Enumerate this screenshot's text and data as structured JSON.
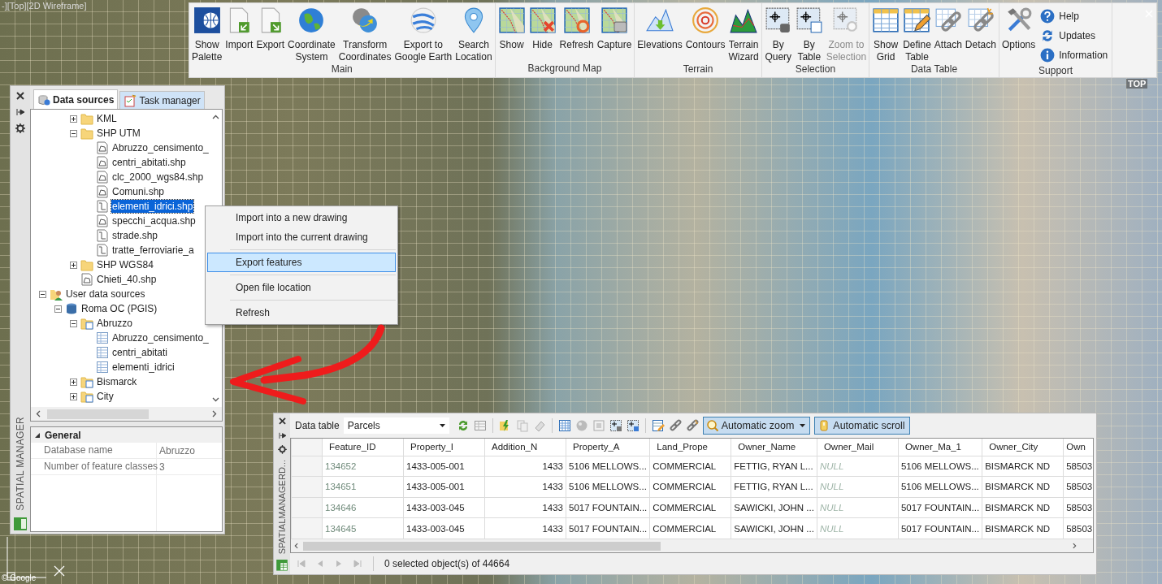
{
  "viewport_label": "-][Top][2D Wireframe]",
  "map": {
    "viewcube_label": "TOP",
    "attribution": "© Google"
  },
  "ribbon": {
    "groups": [
      {
        "label": "Main",
        "buttons": [
          {
            "lines": [
              "Show",
              "Palette"
            ],
            "kind": "large",
            "disabled": false
          },
          {
            "lines": [
              "Import"
            ],
            "kind": "large",
            "disabled": false
          },
          {
            "lines": [
              "Export"
            ],
            "kind": "large",
            "disabled": false
          },
          {
            "lines": [
              "Coordinate",
              "System"
            ],
            "kind": "large",
            "disabled": false
          },
          {
            "lines": [
              "Transform",
              "Coordinates"
            ],
            "kind": "large",
            "disabled": false
          },
          {
            "lines": [
              "Export to",
              "Google Earth"
            ],
            "kind": "large",
            "disabled": false
          },
          {
            "lines": [
              "Search",
              "Location"
            ],
            "kind": "large",
            "disabled": false
          }
        ]
      },
      {
        "label": "Background Map",
        "buttons": [
          {
            "lines": [
              "Show"
            ],
            "kind": "large",
            "disabled": false
          },
          {
            "lines": [
              "Hide"
            ],
            "kind": "large",
            "disabled": false
          },
          {
            "lines": [
              "Refresh"
            ],
            "kind": "large",
            "disabled": false
          },
          {
            "lines": [
              "Capture"
            ],
            "kind": "large",
            "disabled": false
          }
        ]
      },
      {
        "label": "Terrain",
        "buttons": [
          {
            "lines": [
              "Elevations"
            ],
            "kind": "large",
            "disabled": false
          },
          {
            "lines": [
              "Contours"
            ],
            "kind": "large",
            "disabled": false
          },
          {
            "lines": [
              "Terrain",
              "Wizard"
            ],
            "kind": "large",
            "disabled": false
          }
        ]
      },
      {
        "label": "Selection",
        "buttons": [
          {
            "lines": [
              "By",
              "Query"
            ],
            "kind": "large",
            "disabled": false
          },
          {
            "lines": [
              "By",
              "Table"
            ],
            "kind": "large",
            "disabled": false
          },
          {
            "lines": [
              "Zoom to",
              "Selection"
            ],
            "kind": "large",
            "disabled": true
          }
        ]
      },
      {
        "label": "Data Table",
        "buttons": [
          {
            "lines": [
              "Show",
              "Grid"
            ],
            "kind": "large",
            "disabled": false
          },
          {
            "lines": [
              "Define",
              "Table"
            ],
            "kind": "large",
            "disabled": false
          },
          {
            "lines": [
              "Attach"
            ],
            "kind": "large",
            "disabled": false
          },
          {
            "lines": [
              "Detach"
            ],
            "kind": "large",
            "disabled": false
          }
        ]
      },
      {
        "label": "Support",
        "buttons": [
          {
            "lines": [
              "Options"
            ],
            "kind": "large",
            "disabled": false
          },
          {
            "lines": [
              "Help"
            ],
            "kind": "small",
            "disabled": false
          },
          {
            "lines": [
              "Updates"
            ],
            "kind": "small",
            "disabled": false
          },
          {
            "lines": [
              "Information"
            ],
            "kind": "small",
            "disabled": false
          }
        ]
      }
    ]
  },
  "left_panel": {
    "title": "SPATIAL MANAGER",
    "tabs": [
      {
        "label": "Data sources",
        "selected": true
      },
      {
        "label": "Task manager",
        "selected": false
      }
    ],
    "tree": [
      {
        "children": [
          {
            "children": [
              {
                "label": "KML",
                "kind": "folder",
                "expanded": false,
                "selected": false
              },
              {
                "label": "SHP UTM",
                "kind": "folder",
                "expanded": true,
                "selected": false,
                "children": [
                  {
                    "label": "Abruzzo_censimento_",
                    "kind": "polygon-file",
                    "selected": false
                  },
                  {
                    "label": "centri_abitati.shp",
                    "kind": "polygon-file",
                    "selected": false
                  },
                  {
                    "label": "clc_2000_wgs84.shp",
                    "kind": "polygon-file",
                    "selected": false
                  },
                  {
                    "label": "Comuni.shp",
                    "kind": "polygon-file",
                    "selected": false
                  },
                  {
                    "label": "elementi_idrici.shp",
                    "kind": "line-file",
                    "selected": true
                  },
                  {
                    "label": "specchi_acqua.shp",
                    "kind": "polygon-file",
                    "selected": false
                  },
                  {
                    "label": "strade.shp",
                    "kind": "line-file",
                    "selected": false
                  },
                  {
                    "label": "tratte_ferroviarie_a",
                    "kind": "line-file",
                    "selected": false
                  }
                ]
              },
              {
                "label": "SHP WGS84",
                "kind": "folder",
                "expanded": false,
                "selected": false
              },
              {
                "label": "Chieti_40.shp",
                "kind": "polygon-file",
                "selected": false
              }
            ]
          }
        ]
      },
      {
        "label": "User data sources",
        "kind": "user",
        "expanded": true,
        "selected": false,
        "children": [
          {
            "label": "Roma OC (PGIS)",
            "kind": "server",
            "expanded": true,
            "selected": false,
            "children": [
              {
                "label": "Abruzzo",
                "kind": "db-folder",
                "expanded": true,
                "selected": false,
                "children": [
                  {
                    "label": "Abruzzo_censimento_",
                    "kind": "table",
                    "selected": false
                  },
                  {
                    "label": "centri_abitati",
                    "kind": "table",
                    "selected": false
                  },
                  {
                    "label": "elementi_idrici",
                    "kind": "table",
                    "selected": false
                  }
                ]
              },
              {
                "label": "Bismarck",
                "kind": "db-folder",
                "expanded": false,
                "selected": false
              },
              {
                "label": "City",
                "kind": "db-folder",
                "expanded": false,
                "selected": false
              }
            ]
          }
        ]
      }
    ],
    "properties": {
      "category": "General",
      "expanded": true,
      "rows": [
        {
          "name": "Database name",
          "value": "Abruzzo"
        },
        {
          "name": "Number of feature classes",
          "value": "3"
        }
      ]
    }
  },
  "context_menu": {
    "groups": [
      [
        {
          "label": "Import into a new drawing",
          "selected": false
        },
        {
          "label": "Import into the current drawing",
          "selected": false
        }
      ],
      [
        {
          "label": "Export features",
          "selected": true
        }
      ],
      [
        {
          "label": "Open file location",
          "selected": false
        }
      ],
      [
        {
          "label": "Refresh",
          "selected": false
        }
      ]
    ]
  },
  "data_table": {
    "title": "SPATIALMANAGERD...",
    "label": "Data table",
    "layer": "Parcels",
    "toggles": [
      {
        "label": "Automatic zoom",
        "on": true,
        "kind": "dropdown"
      },
      {
        "label": "Automatic scroll",
        "on": true,
        "kind": "plain"
      }
    ],
    "columns": [
      {
        "label": "Feature_ID",
        "kind": "id"
      },
      {
        "label": "Property_I",
        "kind": "text"
      },
      {
        "label": "Addition_N",
        "kind": "number"
      },
      {
        "label": "Property_A",
        "kind": "text"
      },
      {
        "label": "Land_Prope",
        "kind": "text"
      },
      {
        "label": "Owner_Name",
        "kind": "text"
      },
      {
        "label": "Owner_Mail",
        "kind": "null"
      },
      {
        "label": "Owner_Ma_1",
        "kind": "text"
      },
      {
        "label": "Owner_City",
        "kind": "text"
      },
      {
        "label": "Own",
        "kind": "text"
      }
    ],
    "rows": [
      [
        "134652",
        "1433-005-001",
        "1433",
        "5106 MELLOWS...",
        "COMMERCIAL",
        "FETTIG, RYAN L...",
        "NULL",
        "5106 MELLOWS...",
        "BISMARCK ND",
        "58503"
      ],
      [
        "134651",
        "1433-005-001",
        "1433",
        "5106 MELLOWS...",
        "COMMERCIAL",
        "FETTIG, RYAN L...",
        "NULL",
        "5106 MELLOWS...",
        "BISMARCK ND",
        "58503"
      ],
      [
        "134646",
        "1433-003-045",
        "1433",
        "5017 FOUNTAIN...",
        "COMMERCIAL",
        "SAWICKI, JOHN ...",
        "NULL",
        "5017 FOUNTAIN...",
        "BISMARCK ND",
        "58503"
      ],
      [
        "134645",
        "1433-003-045",
        "1433",
        "5017 FOUNTAIN...",
        "COMMERCIAL",
        "SAWICKI, JOHN ...",
        "NULL",
        "5017 FOUNTAIN...",
        "BISMARCK ND",
        "58503"
      ]
    ],
    "status": "0 selected object(s) of 44664"
  }
}
